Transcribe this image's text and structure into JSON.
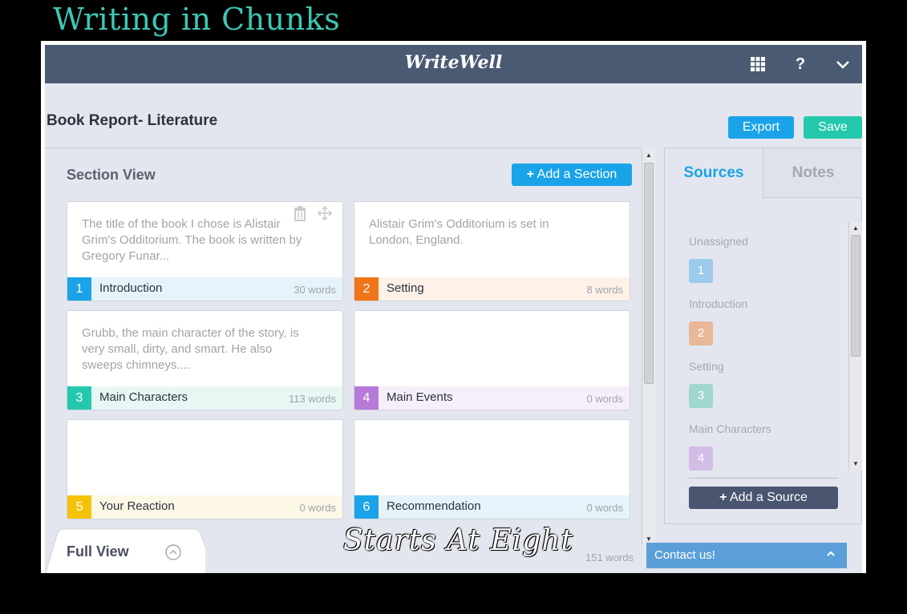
{
  "overlay": {
    "title": "Writing in Chunks",
    "watermark": "Starts At Eight"
  },
  "topbar": {
    "brand": "WriteWell",
    "grid_icon": "grid-icon",
    "help": "?",
    "chevron": "chevron-down-icon"
  },
  "document": {
    "title": "Book Report- Literature"
  },
  "actions": {
    "export": "Export",
    "save": "Save"
  },
  "section_view": {
    "title": "Section View",
    "add_button": "Add a Section",
    "sections": [
      {
        "num": "1",
        "label": "Introduction",
        "words": "30 words",
        "text": "The title of the book I chose is Alistair Grim's Odditorium. The book is written by Gregory Funar...",
        "color": "#1aa3e8",
        "tint": "#e6f3fb"
      },
      {
        "num": "2",
        "label": "Setting",
        "words": "8 words",
        "text": "Alistair Grim's Odditorium is set in London, England.",
        "color": "#f07418",
        "tint": "#fdf1e8"
      },
      {
        "num": "3",
        "label": "Main Characters",
        "words": "113 words",
        "text": "Grubb, the main character of the story, is very small, dirty, and smart. He also sweeps chimneys....",
        "color": "#24c9ad",
        "tint": "#e8f7f4"
      },
      {
        "num": "4",
        "label": "Main Events",
        "words": "0 words",
        "text": "",
        "color": "#b67ad8",
        "tint": "#f6eefb"
      },
      {
        "num": "5",
        "label": "Your Reaction",
        "words": "0 words",
        "text": "",
        "color": "#f5c20a",
        "tint": "#fdf7e6"
      },
      {
        "num": "6",
        "label": "Recommendation",
        "words": "0 words",
        "text": "",
        "color": "#1aa3e8",
        "tint": "#e6f3fb"
      }
    ]
  },
  "full_view": {
    "label": "Full View",
    "total_words": "151 words"
  },
  "sources_panel": {
    "tabs": [
      "Sources",
      "Notes"
    ],
    "groups": [
      {
        "label": "Unassigned",
        "badge": "1",
        "color": "#9ccbeb"
      },
      {
        "label": "Introduction",
        "badge": "2",
        "color": "#e8b899"
      },
      {
        "label": "Setting",
        "badge": "3",
        "color": "#9fd6cf"
      },
      {
        "label": "Main Characters",
        "badge": "4",
        "color": "#d2bde6"
      }
    ],
    "add_button": "Add a Source"
  },
  "contact": {
    "label": "Contact us!"
  }
}
